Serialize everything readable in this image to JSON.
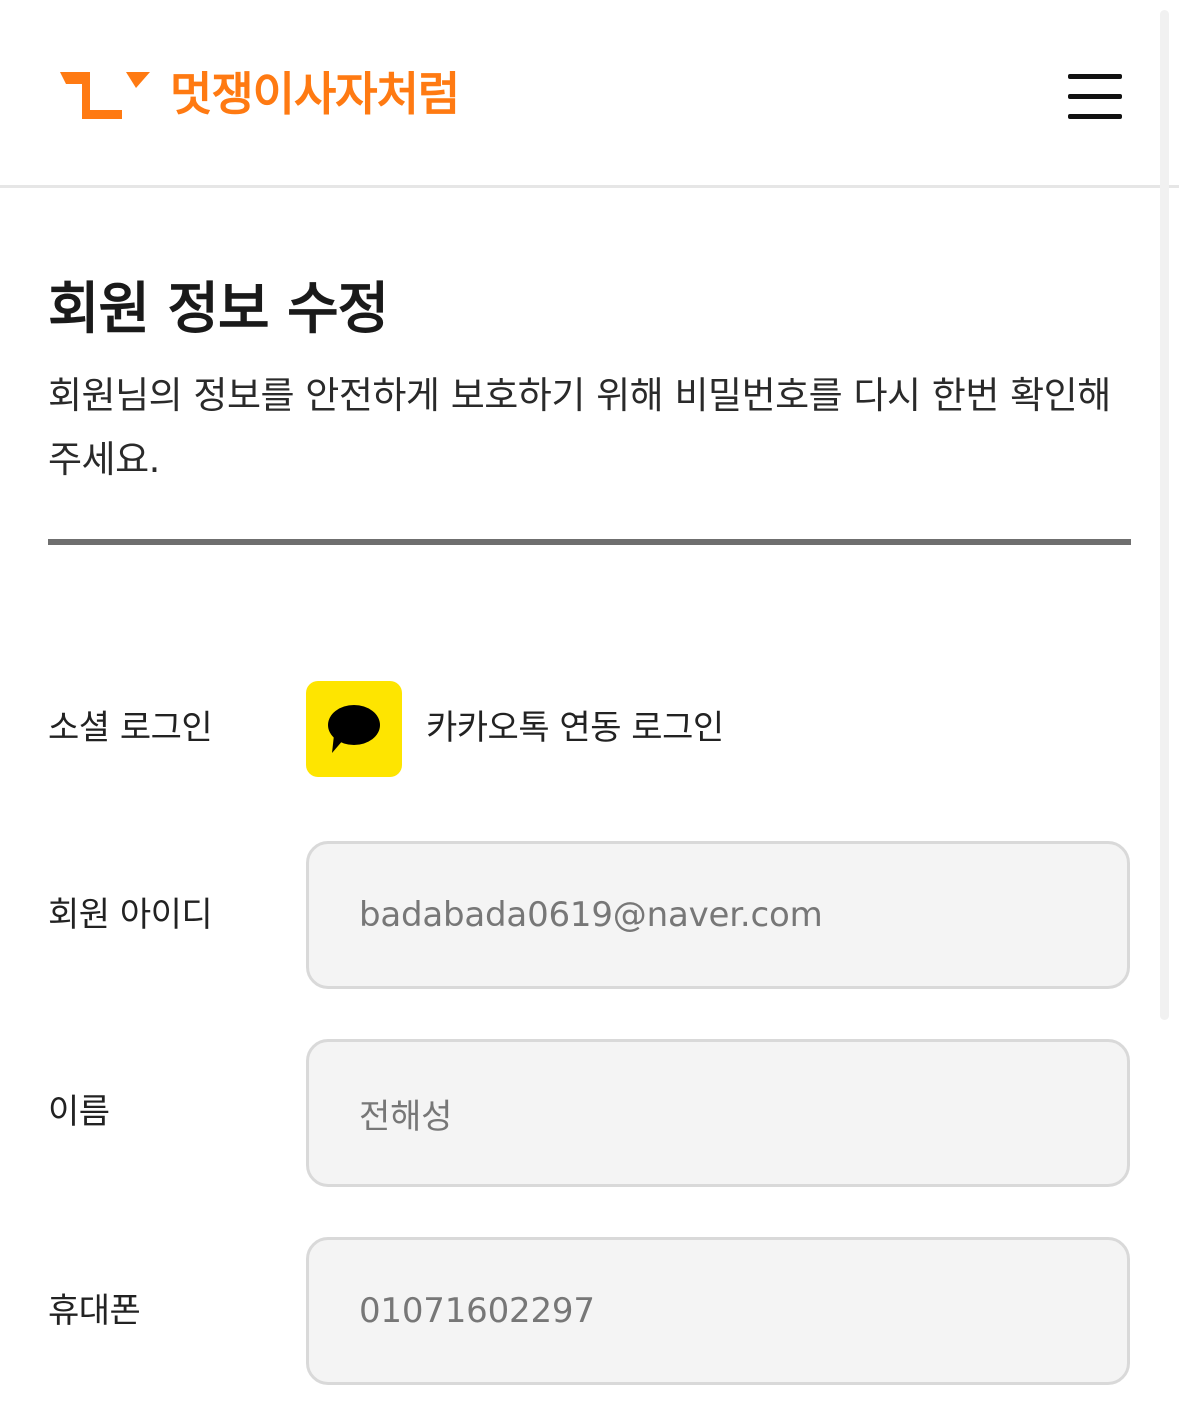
{
  "header": {
    "logo_text": "멋쟁이사자처럼",
    "brand_color": "#ff7a12",
    "menu_icon": "hamburger-menu-icon"
  },
  "main": {
    "title": "회원 정보 수정",
    "description": "회원님의 정보를 안전하게 보호하기 위해 비밀번호를 다시 한번 확인해주세요."
  },
  "form": {
    "social_login": {
      "label": "소셜 로그인",
      "provider_text": "카카오톡 연동 로그인",
      "icon": "kakao-talk-icon",
      "icon_bg_color": "#fee500"
    },
    "member_id": {
      "label": "회원 아이디",
      "value": "badabada0619@naver.com"
    },
    "name": {
      "label": "이름",
      "value": "전해성"
    },
    "phone": {
      "label": "휴대폰",
      "value": "01071602297"
    }
  }
}
